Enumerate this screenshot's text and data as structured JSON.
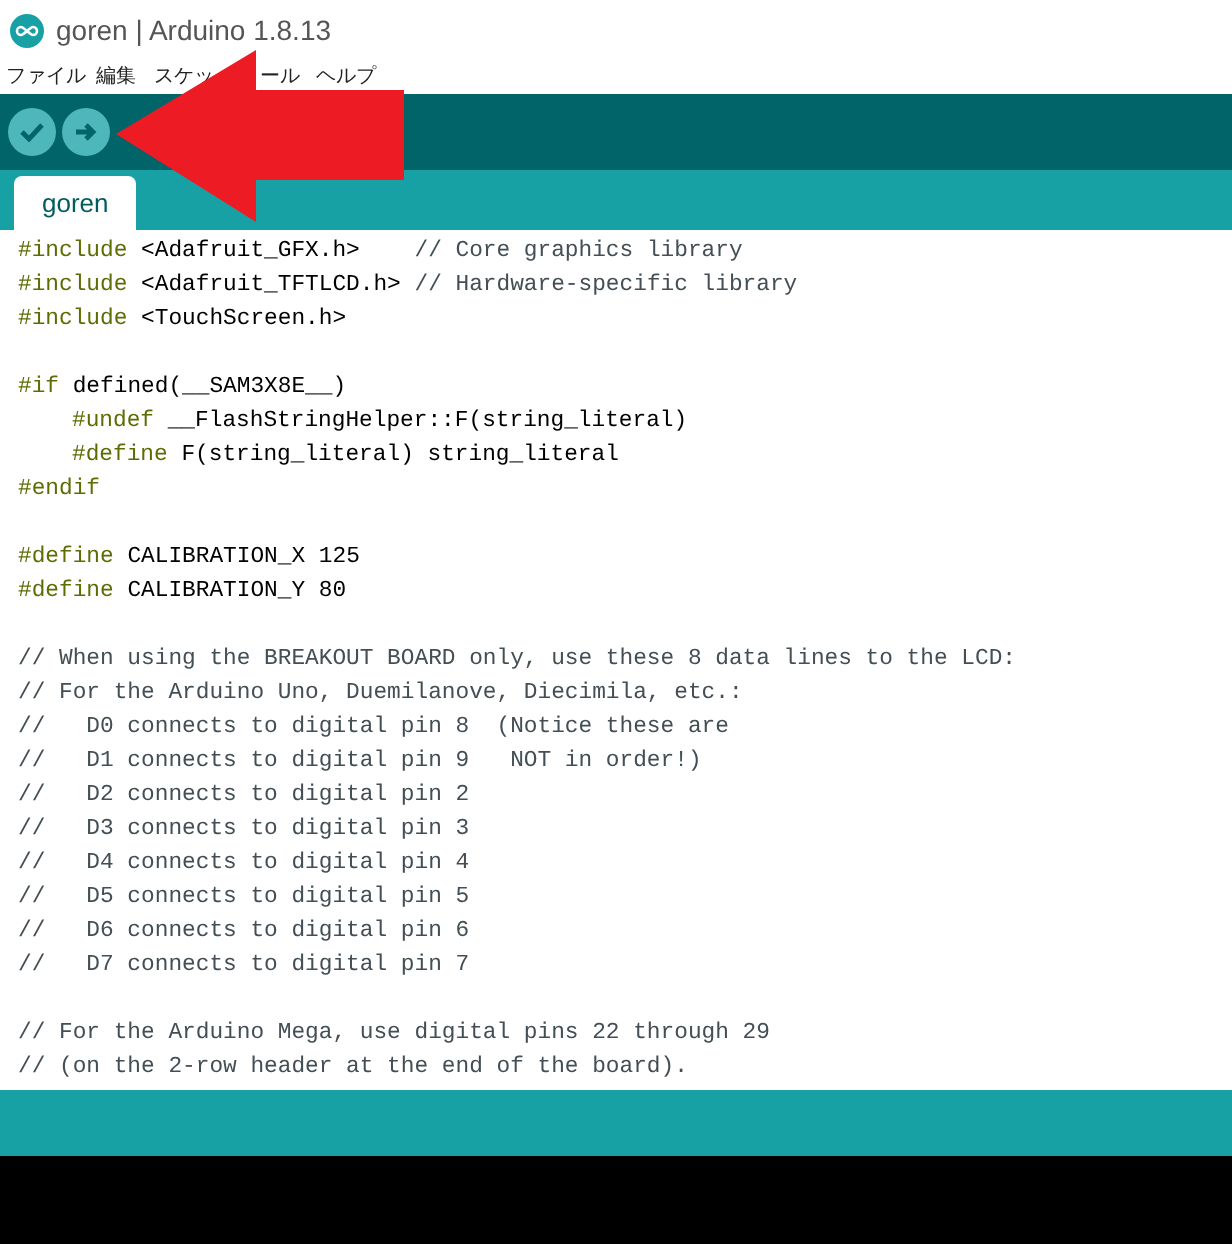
{
  "window": {
    "title": "goren | Arduino 1.8.13"
  },
  "menu": [
    "ファイル",
    "編集",
    "スケッ",
    "ール",
    "ヘルプ"
  ],
  "tabs": [
    {
      "label": "goren",
      "selected": true
    }
  ],
  "code_lines": [
    {
      "kind": "plain",
      "segments": [
        {
          "kind": "directive",
          "text": "#include"
        },
        {
          "kind": "code",
          "text": " <Adafruit_GFX.h>    "
        },
        {
          "kind": "comment",
          "text": "// Core graphics library"
        }
      ]
    },
    {
      "kind": "plain",
      "segments": [
        {
          "kind": "directive",
          "text": "#include"
        },
        {
          "kind": "code",
          "text": " <Adafruit_TFTLCD.h> "
        },
        {
          "kind": "comment",
          "text": "// Hardware-specific library"
        }
      ]
    },
    {
      "kind": "plain",
      "segments": [
        {
          "kind": "directive",
          "text": "#include"
        },
        {
          "kind": "code",
          "text": " <TouchScreen.h>"
        }
      ]
    },
    {
      "kind": "blank"
    },
    {
      "kind": "plain",
      "segments": [
        {
          "kind": "directive",
          "text": "#if"
        },
        {
          "kind": "code",
          "text": " defined(__SAM3X8E__)"
        }
      ]
    },
    {
      "kind": "indented",
      "segments": [
        {
          "kind": "directive",
          "text": "#undef"
        },
        {
          "kind": "code",
          "text": " __FlashStringHelper::F(string_literal)"
        }
      ]
    },
    {
      "kind": "indented",
      "segments": [
        {
          "kind": "directive",
          "text": "#define"
        },
        {
          "kind": "code",
          "text": " F(string_literal) string_literal"
        }
      ]
    },
    {
      "kind": "plain",
      "segments": [
        {
          "kind": "directive",
          "text": "#endif"
        }
      ]
    },
    {
      "kind": "blank"
    },
    {
      "kind": "plain",
      "segments": [
        {
          "kind": "directive",
          "text": "#define"
        },
        {
          "kind": "code",
          "text": " CALIBRATION_X 125"
        }
      ]
    },
    {
      "kind": "plain",
      "segments": [
        {
          "kind": "directive",
          "text": "#define"
        },
        {
          "kind": "code",
          "text": " CALIBRATION_Y 80"
        }
      ]
    },
    {
      "kind": "blank"
    },
    {
      "kind": "plain",
      "segments": [
        {
          "kind": "comment",
          "text": "// When using the BREAKOUT BOARD only, use these 8 data lines to the LCD:"
        }
      ]
    },
    {
      "kind": "plain",
      "segments": [
        {
          "kind": "comment",
          "text": "// For the Arduino Uno, Duemilanove, Diecimila, etc.:"
        }
      ]
    },
    {
      "kind": "plain",
      "segments": [
        {
          "kind": "comment",
          "text": "//   D0 connects to digital pin 8  (Notice these are"
        }
      ]
    },
    {
      "kind": "plain",
      "segments": [
        {
          "kind": "comment",
          "text": "//   D1 connects to digital pin 9   NOT in order!)"
        }
      ]
    },
    {
      "kind": "plain",
      "segments": [
        {
          "kind": "comment",
          "text": "//   D2 connects to digital pin 2"
        }
      ]
    },
    {
      "kind": "plain",
      "segments": [
        {
          "kind": "comment",
          "text": "//   D3 connects to digital pin 3"
        }
      ]
    },
    {
      "kind": "plain",
      "segments": [
        {
          "kind": "comment",
          "text": "//   D4 connects to digital pin 4"
        }
      ]
    },
    {
      "kind": "plain",
      "segments": [
        {
          "kind": "comment",
          "text": "//   D5 connects to digital pin 5"
        }
      ]
    },
    {
      "kind": "plain",
      "segments": [
        {
          "kind": "comment",
          "text": "//   D6 connects to digital pin 6"
        }
      ]
    },
    {
      "kind": "plain",
      "segments": [
        {
          "kind": "comment",
          "text": "//   D7 connects to digital pin 7"
        }
      ]
    },
    {
      "kind": "blank"
    },
    {
      "kind": "plain",
      "segments": [
        {
          "kind": "comment",
          "text": "// For the Arduino Mega, use digital pins 22 through 29"
        }
      ]
    },
    {
      "kind": "plain",
      "segments": [
        {
          "kind": "comment",
          "text": "// (on the 2-row header at the end of the board)."
        }
      ]
    }
  ]
}
